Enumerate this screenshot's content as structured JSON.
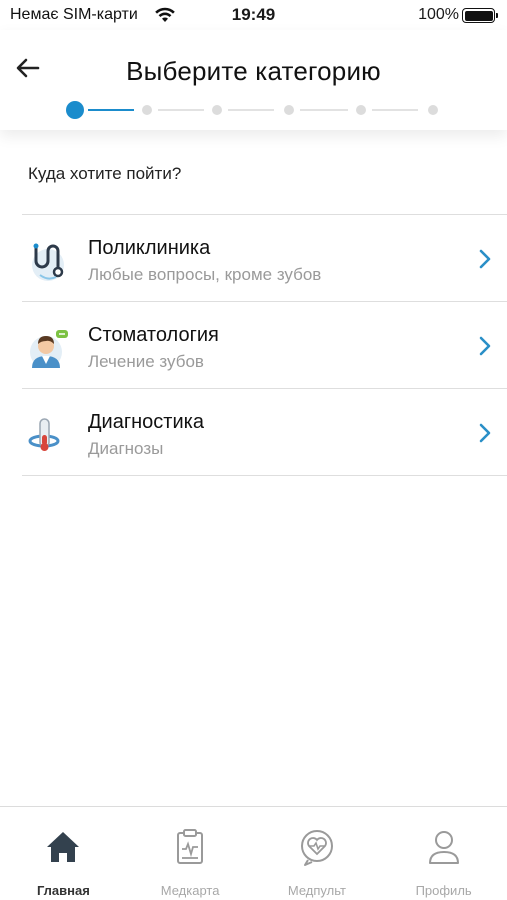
{
  "status_bar": {
    "carrier": "Немає SIM-карти",
    "time": "19:49",
    "battery": "100%"
  },
  "header": {
    "title": "Выберите категорию",
    "steps_total": 6,
    "current_step": 1
  },
  "content": {
    "question": "Куда хотите пойти?",
    "categories": [
      {
        "title": "Поликлиника",
        "subtitle": "Любые вопросы, кроме зубов",
        "icon": "stethoscope-icon"
      },
      {
        "title": "Стоматология",
        "subtitle": "Лечение зубов",
        "icon": "dentist-icon"
      },
      {
        "title": "Диагностика",
        "subtitle": "Диагнозы",
        "icon": "diagnostics-icon"
      }
    ]
  },
  "tab_bar": {
    "tabs": [
      {
        "label": "Главная",
        "icon": "home-icon",
        "active": true
      },
      {
        "label": "Медкарта",
        "icon": "medical-card-icon",
        "active": false
      },
      {
        "label": "Медпульт",
        "icon": "heart-pulse-icon",
        "active": false
      },
      {
        "label": "Профиль",
        "icon": "profile-icon",
        "active": false
      }
    ]
  },
  "colors": {
    "accent": "#1b8ccc",
    "chevron": "#2a8fc7",
    "inactive_tab": "#a8a8a8"
  }
}
